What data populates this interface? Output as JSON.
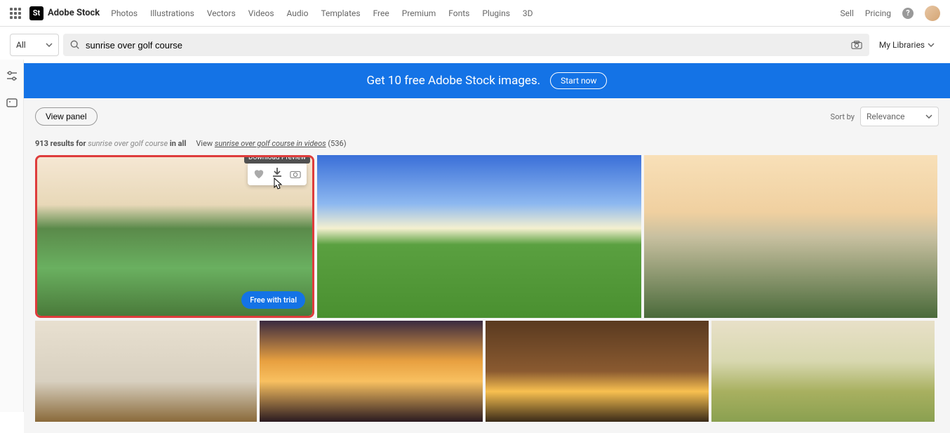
{
  "header": {
    "brand": "Adobe Stock",
    "logo_glyph": "St",
    "nav": [
      "Photos",
      "Illustrations",
      "Vectors",
      "Videos",
      "Audio",
      "Templates",
      "Free",
      "Premium",
      "Fonts",
      "Plugins",
      "3D"
    ],
    "sell": "Sell",
    "pricing": "Pricing"
  },
  "search": {
    "category": "All",
    "query": "sunrise over golf course",
    "my_libraries": "My Libraries"
  },
  "banner": {
    "text": "Get 10 free Adobe Stock images.",
    "cta": "Start now"
  },
  "controls": {
    "view_panel": "View panel",
    "sort_by_label": "Sort by",
    "sort_value": "Relevance"
  },
  "results": {
    "count": "913 results for",
    "query": "sunrise over golf course",
    "in_all": "in all",
    "view_prefix": "View",
    "videos_link": "sunrise over golf course",
    "videos_suffix": " in videos",
    "videos_count": "(536)"
  },
  "thumb": {
    "tooltip": "Download Preview",
    "free_trial": "Free with trial"
  }
}
